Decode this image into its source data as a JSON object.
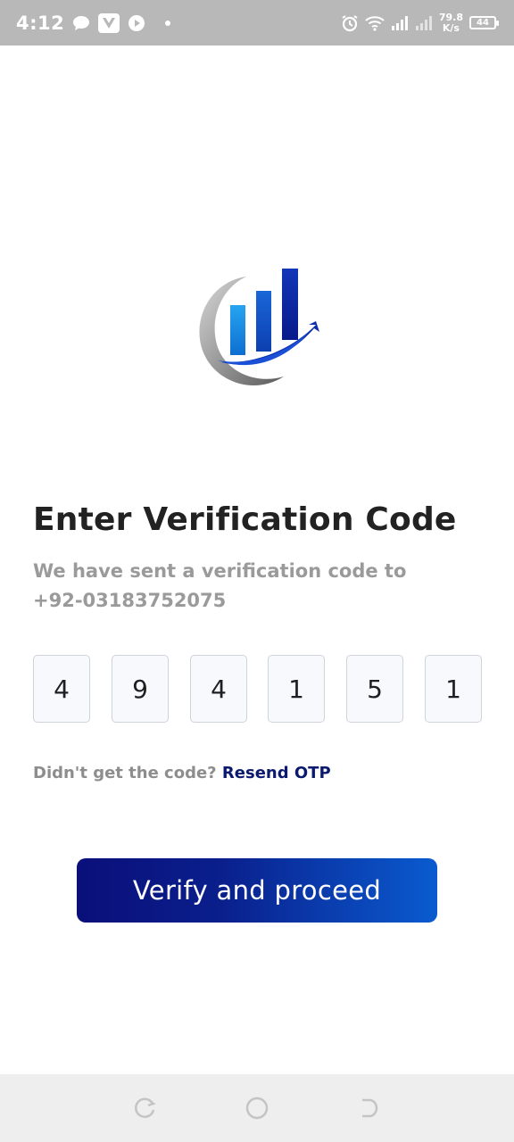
{
  "status_bar": {
    "time": "4:12",
    "net_speed_value": "79.8",
    "net_speed_unit": "K/s",
    "battery": "44",
    "icons": [
      "chat-bubble-icon",
      "v-app-icon",
      "play-icon",
      "dot-icon",
      "alarm-icon",
      "wifi-icon",
      "signal-icon",
      "signal-icon-2"
    ]
  },
  "logo": {
    "icon": "growth-chart-logo",
    "colors": {
      "bar_light": "#1a8fe0",
      "bar_mid": "#1556c8",
      "bar_dark": "#0b1e9e",
      "swoosh_gray": "#8c8c8c"
    }
  },
  "verification": {
    "title": "Enter Verification Code",
    "subtitle_line1": "We have sent a verification code to",
    "phone": "+92-03183752075",
    "digits": [
      "4",
      "9",
      "4",
      "1",
      "5",
      "1"
    ],
    "resend_prompt": "Didn't get the code?",
    "resend_link": "Resend OTP",
    "verify_button": "Verify and proceed"
  },
  "colors": {
    "accent_dark": "#0a0f7a",
    "accent_light": "#0a5bd0",
    "link": "#0b1a6e",
    "status_bar_bg": "#b8b8b8"
  },
  "nav_bar": {
    "icons": [
      "recents-icon",
      "home-icon",
      "back-icon"
    ]
  }
}
